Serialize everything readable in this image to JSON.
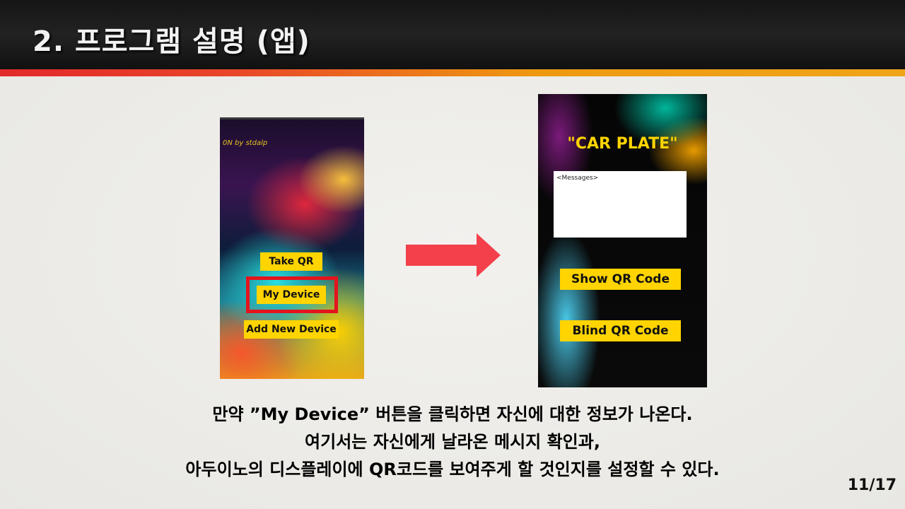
{
  "header": {
    "title": "2. 프로그램 설명 (앱)"
  },
  "phone1": {
    "credit": "0N by stdalp",
    "buttons": {
      "take_qr": "Take QR",
      "my_device": "My Device",
      "add_new_device": "Add New Device"
    },
    "highlight_color": "#e3141e"
  },
  "phone2": {
    "title": "\"CAR PLATE\"",
    "messages_placeholder": "<Messages>",
    "buttons": {
      "show_qr": "Show QR Code",
      "blind_qr": "Blind QR Code"
    }
  },
  "caption": {
    "line1": "만약 ”My Device” 버튼을 클릭하면 자신에 대한 정보가 나온다.",
    "line2": "여기서는 자신에게 날라온 메시지 확인과,",
    "line3": "아두이노의 디스플레이에 QR코드를 보여주게 할 것인지를 설정할 수 있다."
  },
  "page": {
    "number": "11/17"
  },
  "colors": {
    "accent_yellow": "#ffd400",
    "arrow": "#f4404a",
    "stripe_red": "#e2292b",
    "stripe_orange": "#f0a417"
  }
}
